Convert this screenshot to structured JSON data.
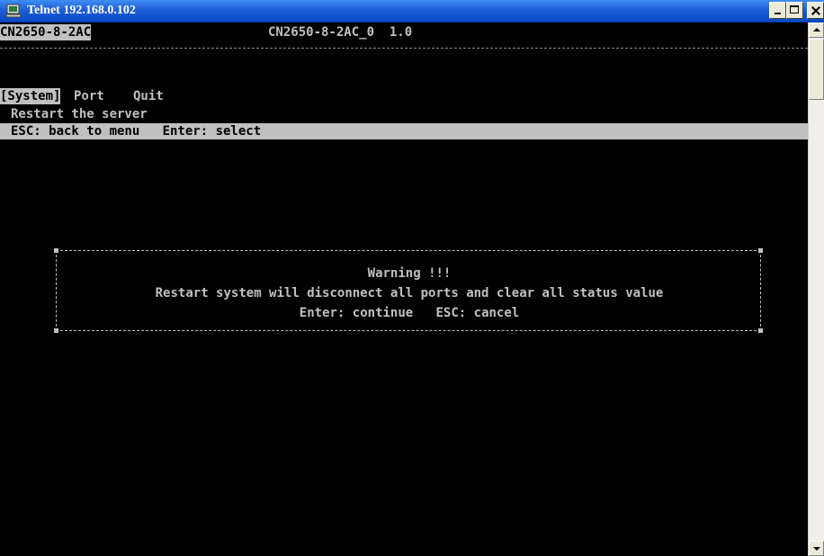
{
  "window": {
    "title": "Telnet 192.168.0.102",
    "icon": "telnet-computer-icon"
  },
  "terminal": {
    "model": "CN2650-8-2AC",
    "server_info": "CN2650-8-2AC_0  1.0",
    "menu": {
      "system": "[System]",
      "port": "Port",
      "quit": "Quit"
    },
    "description": "Restart the server",
    "hint": "ESC: back to menu   Enter: select",
    "dialog": {
      "title": "Warning !!!",
      "message": "Restart system will disconnect all ports and clear all status value",
      "actions": "Enter: continue   ESC: cancel"
    }
  },
  "colors": {
    "terminal_bg": "#000000",
    "terminal_fg": "#c0c0c0",
    "titlebar": "#0a49c8"
  }
}
